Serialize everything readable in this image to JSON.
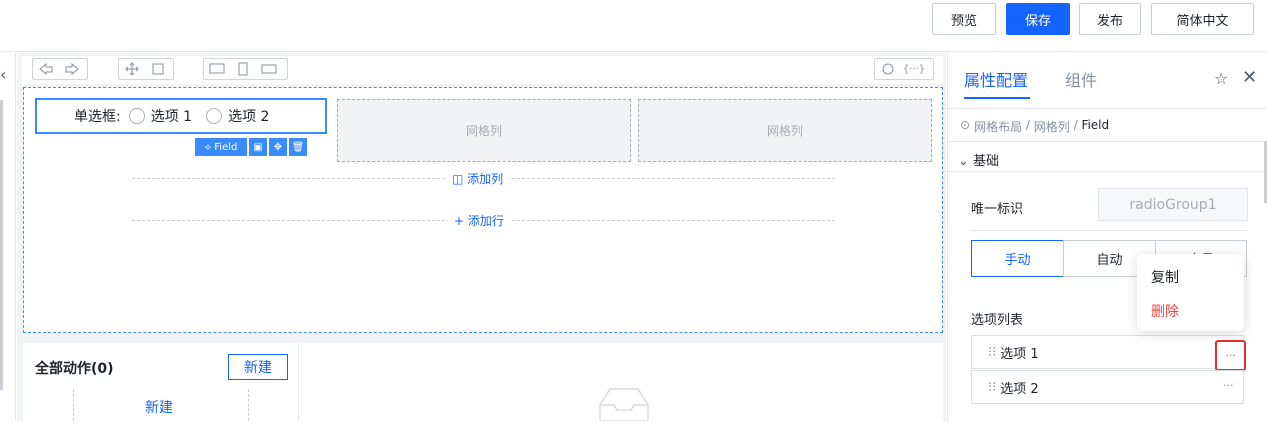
{
  "topbar": {
    "preview_label": "预览",
    "save_label": "保存",
    "publish_label": "发布",
    "language_label": "简体中文"
  },
  "canvas": {
    "radio_field": {
      "label": "单选框:",
      "options": [
        "选项 1",
        "选项 2"
      ]
    },
    "field_tag": "Field",
    "grid_col_label": "网格列",
    "add_column_label": "添加列",
    "add_row_label": "添加行"
  },
  "actions": {
    "title": "全部动作(0)",
    "new_button": "新建",
    "new_link": "新建"
  },
  "right_panel": {
    "tabs": [
      "属性配置",
      "组件"
    ],
    "breadcrumb": [
      "网格布局",
      "网格列",
      "Field"
    ],
    "section_title": "基础",
    "unique_id_label": "唯一标识",
    "unique_id_value": "radioGroup1",
    "segments": [
      "手动",
      "自动",
      "变量"
    ],
    "options_list_label": "选项列表",
    "options": [
      "选项 1",
      "选项 2"
    ],
    "more_label": "···"
  },
  "context_menu": {
    "copy": "复制",
    "delete": "删除"
  },
  "colors": {
    "primary": "#1664ff",
    "danger": "#f53f3f",
    "highlight_border": "#e0302c"
  }
}
